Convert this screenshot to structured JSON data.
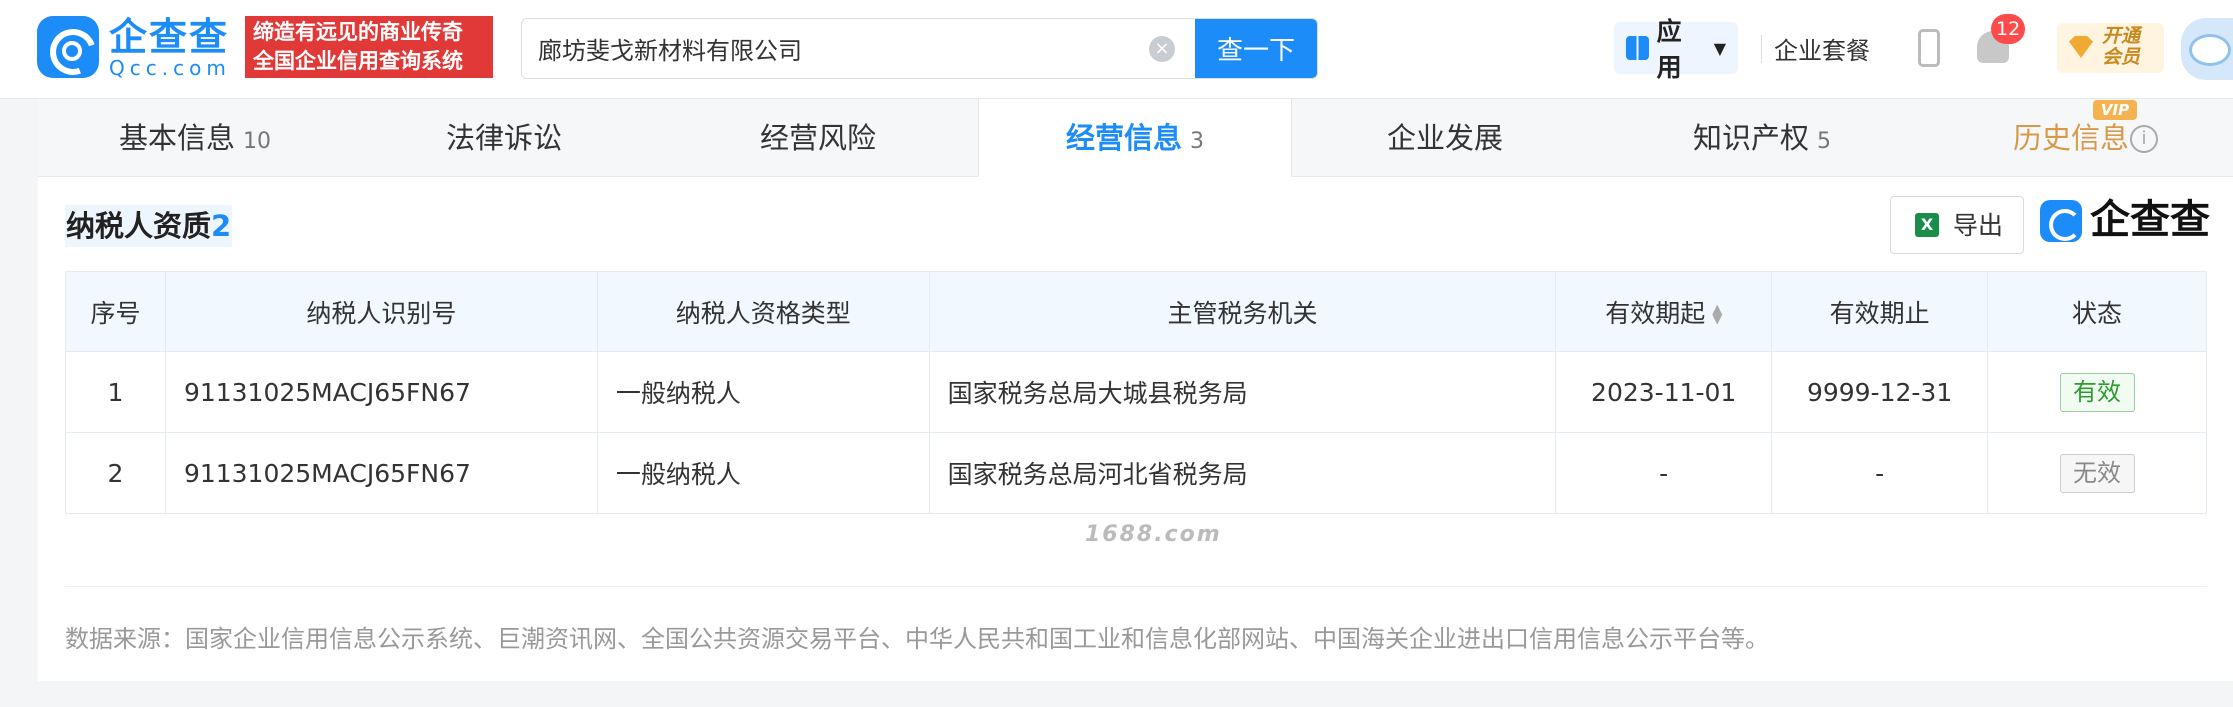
{
  "header": {
    "logo_cn": "企查查",
    "logo_en": "Qcc.com",
    "slogan_line1": "缔造有远见的商业传奇",
    "slogan_line2": "全国企业信用查询系统",
    "search_value": "廊坊斐戈新材料有限公司",
    "search_button": "查一下",
    "apps_label": "应用",
    "suite_label": "企业套餐",
    "notification_count": "12",
    "vip_line1": "开通",
    "vip_line2": "会员"
  },
  "tabs": [
    {
      "label": "基本信息",
      "count": "10"
    },
    {
      "label": "法律诉讼",
      "count": ""
    },
    {
      "label": "经营风险",
      "count": ""
    },
    {
      "label": "经营信息",
      "count": "3"
    },
    {
      "label": "企业发展",
      "count": ""
    },
    {
      "label": "知识产权",
      "count": "5"
    },
    {
      "label": "历史信息",
      "count": ""
    }
  ],
  "vip_tag": "VIP",
  "info_icon": "i",
  "section": {
    "title": "纳税人资质",
    "count": "2",
    "export_label": "导出",
    "brand": "企查查"
  },
  "table": {
    "headers": [
      "序号",
      "纳税人识别号",
      "纳税人资格类型",
      "主管税务机关",
      "有效期起",
      "有效期止",
      "状态"
    ],
    "rows": [
      [
        "1",
        "91131025MACJ65FN67",
        "一般纳税人",
        "国家税务总局大城县税务局",
        "2023-11-01",
        "9999-12-31",
        "有效"
      ],
      [
        "2",
        "91131025MACJ65FN67",
        "一般纳税人",
        "国家税务总局河北省税务局",
        "-",
        "-",
        "无效"
      ]
    ]
  },
  "watermark": "1688.com",
  "source": "数据来源：国家企业信用信息公示系统、巨潮资讯网、全国公共资源交易平台、中华人民共和国工业和信息化部网站、中国海关企业进出口信用信息公示平台等。",
  "colors": {
    "brand_blue": "#1c8cf8",
    "slogan_red": "#e13838",
    "valid_green": "#2e9b2e",
    "vip_gold": "#d89a4a"
  },
  "icons": [
    "qcc-logo-icon",
    "clear-icon",
    "apps-icon",
    "chevron-down-icon",
    "phone-icon",
    "bell-icon",
    "vip-gem-icon",
    "avatar-icon",
    "info-icon",
    "excel-icon",
    "sort-icon",
    "brand-icon"
  ]
}
